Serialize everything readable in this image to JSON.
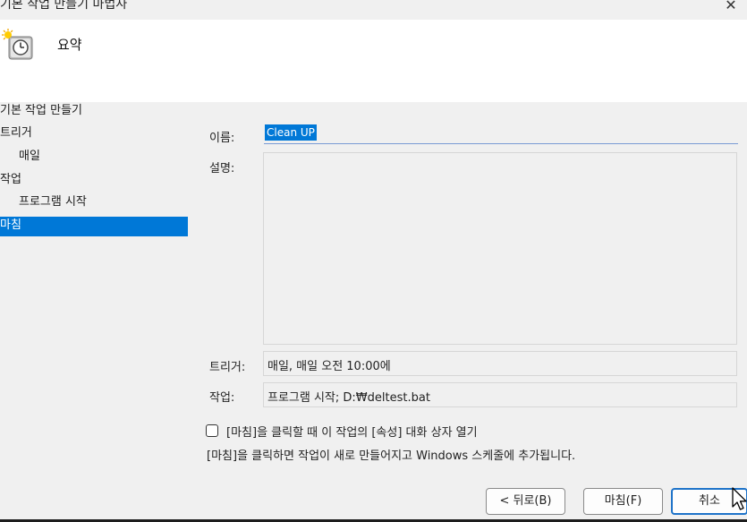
{
  "window": {
    "title": "기본 작업 만들기 마법사",
    "close_label": "✕"
  },
  "header": {
    "heading": "요약",
    "icon": "task-clock-icon"
  },
  "nav": {
    "items": [
      {
        "label": "기본 작업 만들기",
        "level": 0,
        "selected": false
      },
      {
        "label": "트리거",
        "level": 0,
        "selected": false
      },
      {
        "label": "매일",
        "level": 1,
        "selected": false
      },
      {
        "label": "작업",
        "level": 0,
        "selected": false
      },
      {
        "label": "프로그램 시작",
        "level": 1,
        "selected": false
      },
      {
        "label": "마침",
        "level": 0,
        "selected": true
      }
    ]
  },
  "summary": {
    "name_label": "이름:",
    "name_value": "Clean UP",
    "description_label": "설명:",
    "description_value": "",
    "trigger_label": "트리거:",
    "trigger_value": "매일, 매일 오전 10:00에",
    "action_label": "작업:",
    "action_value": "프로그램 시작; D:₩deltest.bat"
  },
  "options": {
    "open_properties_label": "[마침]을 클릭할 때 이 작업의 [속성] 대화 상자 열기",
    "open_properties_checked": false,
    "info_text": "[마침]을 클릭하면 작업이 새로 만들어지고 Windows 스케줄에 추가됩니다."
  },
  "buttons": {
    "back_label": "< 뒤로(B)",
    "finish_label": "마침(F)",
    "cancel_label": "취소"
  },
  "colors": {
    "accent": "#0078d7",
    "window_bg": "#f0f0f0",
    "header_bg": "#ffffff"
  }
}
